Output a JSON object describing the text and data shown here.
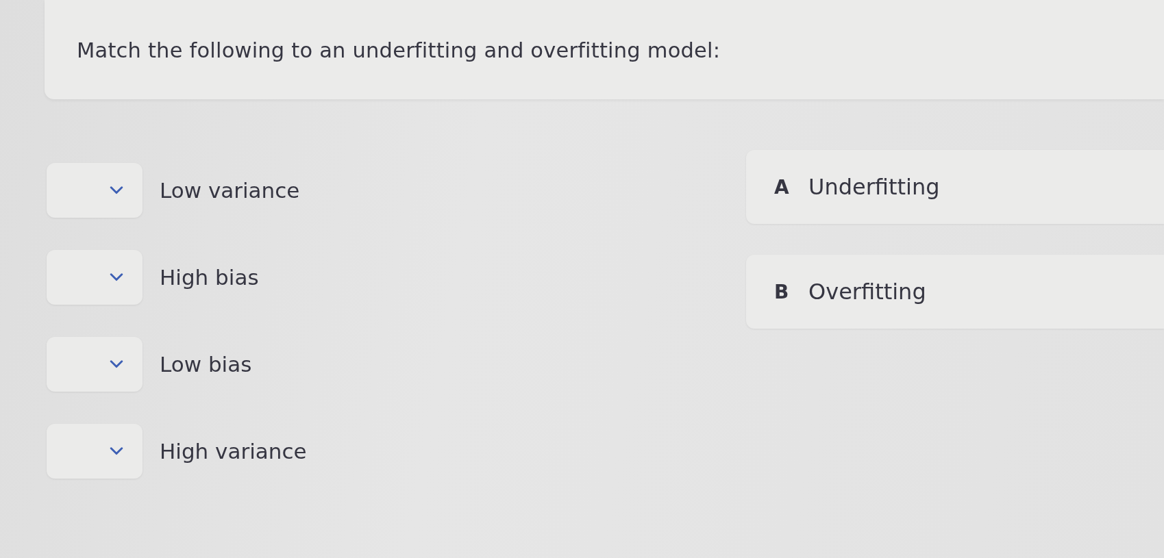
{
  "question": {
    "text": "Match the following to an underfitting and overfitting model:"
  },
  "prompts": [
    {
      "label": "Low variance"
    },
    {
      "label": "High bias"
    },
    {
      "label": "Low bias"
    },
    {
      "label": "High variance"
    }
  ],
  "options": [
    {
      "letter": "A",
      "label": "Underfitting"
    },
    {
      "letter": "B",
      "label": "Overfitting"
    }
  ]
}
